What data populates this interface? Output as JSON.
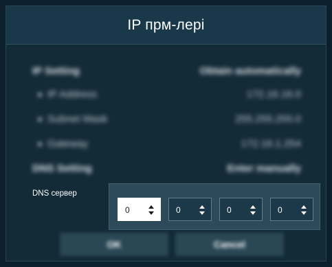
{
  "dialog": {
    "title": "IP прм-лері"
  },
  "blurred_settings": {
    "ip_setting_label": "IP Setting",
    "ip_setting_value": "Obtain automatically",
    "ip_address_label": "IP Address",
    "ip_address_value": "172.16.16.0",
    "subnet_label": "Subnet Mask",
    "subnet_value": "255.255.255.0",
    "gateway_label": "Gateway",
    "gateway_value": "172.16.1.254",
    "dns_setting_label": "DNS Setting",
    "dns_setting_value": "Enter manually"
  },
  "dns": {
    "label": "DNS сервер",
    "octets": [
      "0",
      "0",
      "0",
      "0"
    ],
    "focused_index": 0,
    "icon": "up-down-arrows-icon"
  },
  "buttons": {
    "ok_label": "OK",
    "cancel_label": "Cancel"
  },
  "colors": {
    "background": "#0b1f2c",
    "dialog": "#132a37",
    "header": "#19384a",
    "dns_panel": "#2c4a5a",
    "octet_field": "#1b3948",
    "focused_field": "#ffffff"
  }
}
